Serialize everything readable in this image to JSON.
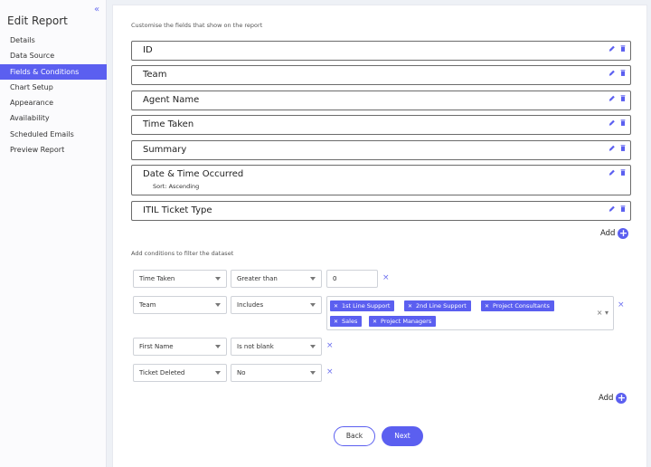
{
  "sidebar": {
    "collapse_glyph": "«",
    "title": "Edit Report",
    "items": [
      {
        "label": "Details"
      },
      {
        "label": "Data Source"
      },
      {
        "label": "Fields & Conditions"
      },
      {
        "label": "Chart Setup"
      },
      {
        "label": "Appearance"
      },
      {
        "label": "Availability"
      },
      {
        "label": "Scheduled Emails"
      },
      {
        "label": "Preview Report"
      }
    ],
    "active_item": "Fields & Conditions"
  },
  "fields": {
    "hint": "Customise the fields that show on the report",
    "rows": [
      {
        "label": "ID"
      },
      {
        "label": "Team"
      },
      {
        "label": "Agent Name"
      },
      {
        "label": "Time Taken"
      },
      {
        "label": "Summary"
      },
      {
        "label": "Date & Time Occurred",
        "sub": "Sort: Ascending"
      },
      {
        "label": "ITIL Ticket Type"
      }
    ],
    "add_label": "Add"
  },
  "conditions": {
    "hint": "Add conditions to filter the dataset",
    "rows": [
      {
        "field": "Time Taken",
        "operator": "Greater than",
        "value": "0"
      },
      {
        "field": "Team",
        "operator": "Includes",
        "chips": [
          "1st Line Support",
          "2nd Line Support",
          "Project Consultants",
          "Sales",
          "Project Managers"
        ]
      },
      {
        "field": "First Name",
        "operator": "Is not blank"
      },
      {
        "field": "Ticket Deleted",
        "operator": "No"
      }
    ],
    "remove_glyph": "×",
    "add_label": "Add"
  },
  "footer": {
    "back_label": "Back",
    "next_label": "Next"
  },
  "colors": {
    "accent": "#5b5ff0"
  }
}
